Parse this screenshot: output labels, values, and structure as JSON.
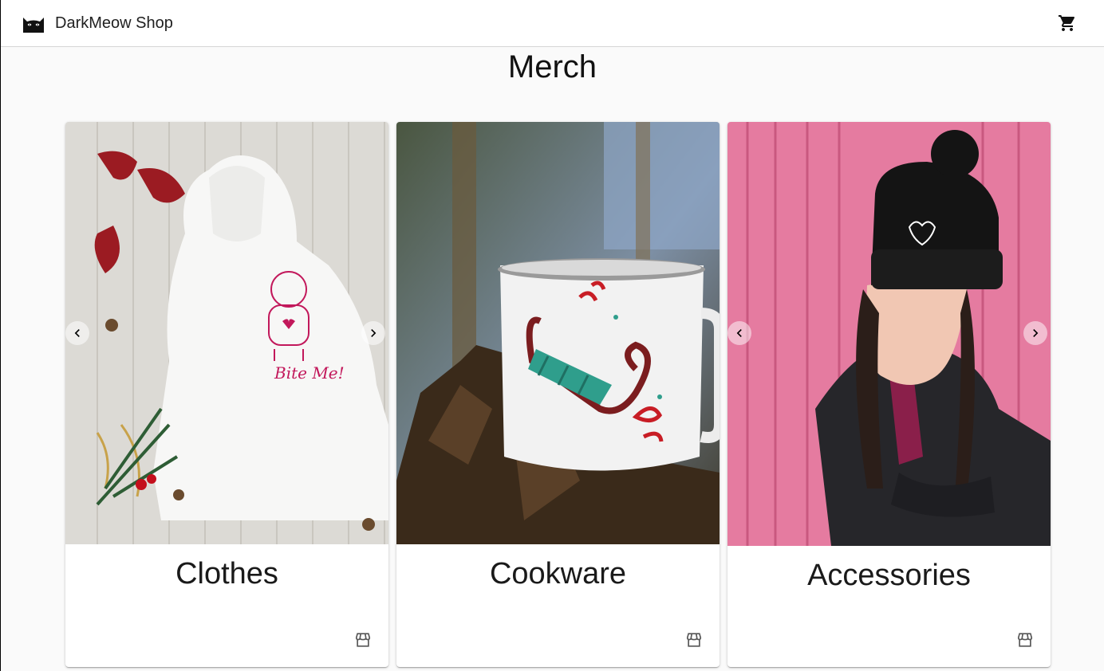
{
  "app": {
    "brand_name": "DarkMeow Shop",
    "logo_icon": "black-cat-icon",
    "cart_icon": "shopping-cart-icon"
  },
  "page": {
    "title": "Merch"
  },
  "categories": [
    {
      "title": "Clothes",
      "image": "white hoodie with gingerbread print",
      "print_text": "Bite Me!",
      "store_icon": "storefront-icon",
      "carousel": {
        "prev": "chevron-left-icon",
        "next": "chevron-right-icon"
      }
    },
    {
      "title": "Cookware",
      "image": "enamel mug with sled print",
      "store_icon": "storefront-icon"
    },
    {
      "title": "Accessories",
      "image": "black beanie with heart print",
      "store_icon": "storefront-icon",
      "carousel": {
        "prev": "chevron-left-icon",
        "next": "chevron-right-icon"
      }
    }
  ],
  "colors": {
    "appbar": "#ffffff",
    "background": "#fafafa",
    "text": "#212121",
    "hoodie_print": "#c2185b",
    "wall_pink": "#e57ba0"
  }
}
